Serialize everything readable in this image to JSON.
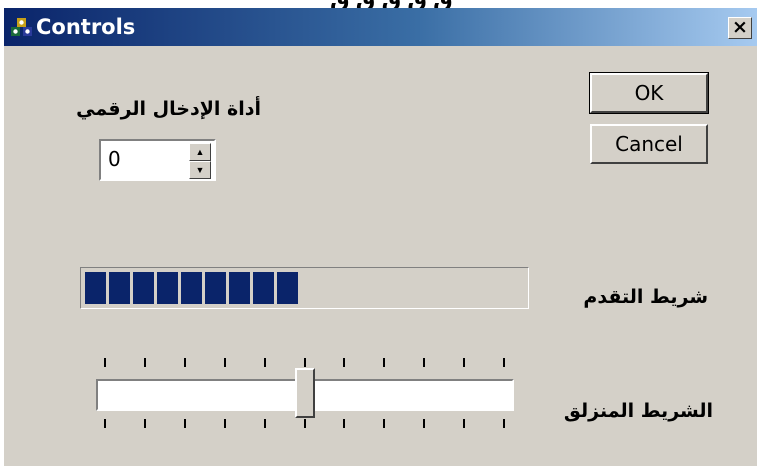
{
  "window": {
    "title": "Controls",
    "close_label": "×"
  },
  "buttons": {
    "ok": "OK",
    "cancel": "Cancel"
  },
  "spinner": {
    "label": "أداة الإدخال الرقمي",
    "value": "0"
  },
  "progress": {
    "label": "شريط التقدم",
    "value": 0.5,
    "color": "#0a246a"
  },
  "slider": {
    "label": "الشريط المنزلق",
    "value": 5,
    "min": 0,
    "max": 10
  },
  "icons": {
    "app": "controls-app-icon",
    "close": "close-icon",
    "spin_up": "spin-up-arrow-icon",
    "spin_down": "spin-down-arrow-icon"
  }
}
